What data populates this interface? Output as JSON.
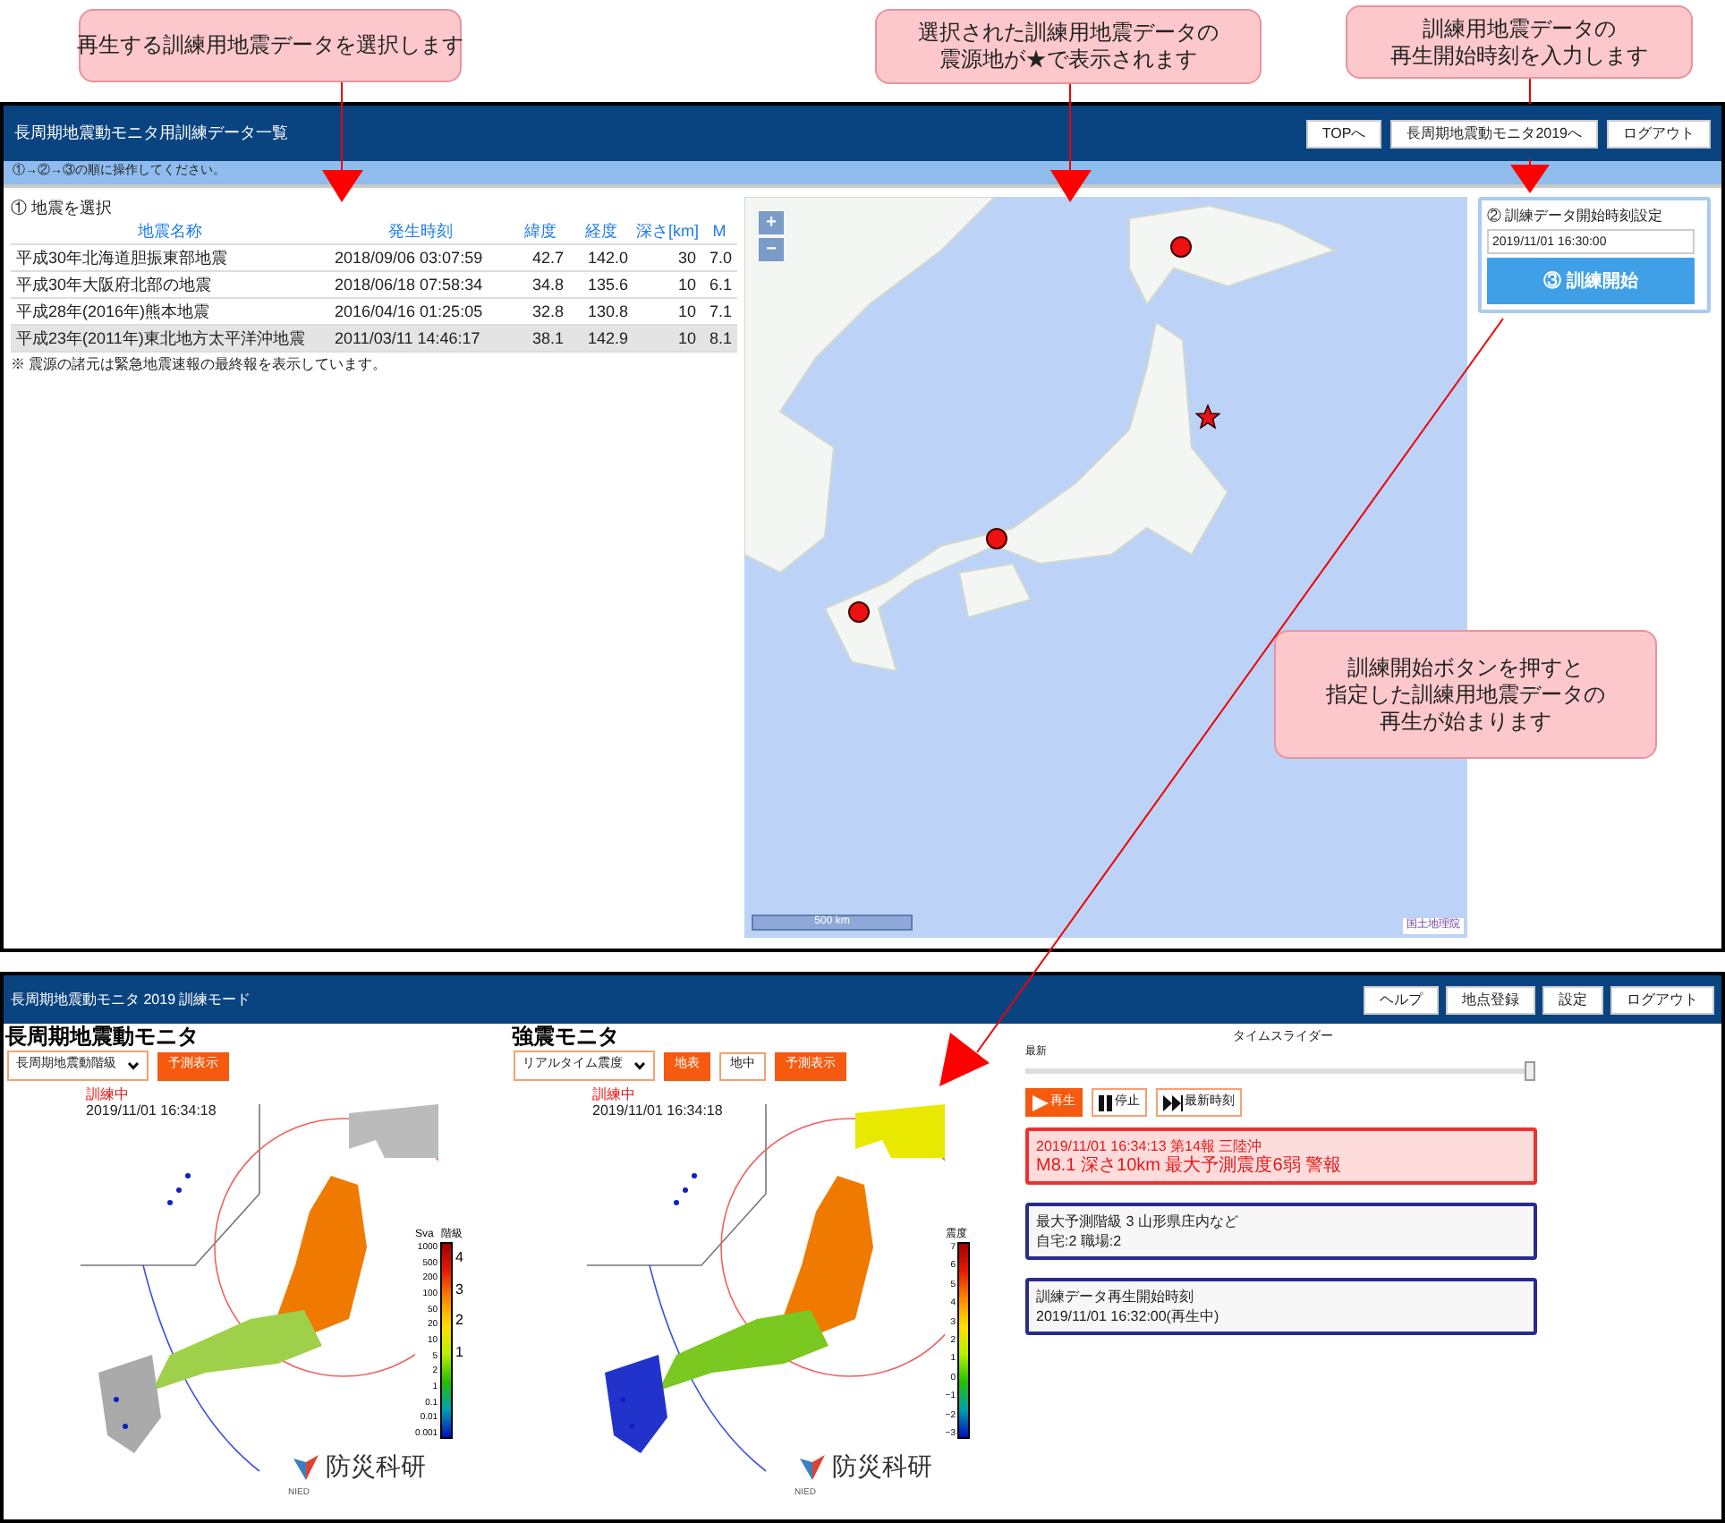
{
  "callouts": [
    {
      "lines": [
        "再生する訓練用地震データを選択します"
      ]
    },
    {
      "lines": [
        "選択された訓練用地震データの",
        "震源地が★で表示されます"
      ]
    },
    {
      "lines": [
        "訓練用地震データの",
        "再生開始時刻を入力します"
      ]
    },
    {
      "lines": [
        "訓練開始ボタンを押すと",
        "指定した訓練用地震データの",
        "再生が始まります"
      ]
    }
  ],
  "training_list_window": {
    "title": "長周期地震動モニタ用訓練データ一覧",
    "header_buttons": [
      "TOPへ",
      "長周期地震動モニタ2019へ",
      "ログアウト"
    ],
    "instruction": "①→②→③の順に操作してください。",
    "step1_label": "① 地震を選択",
    "table": {
      "columns": [
        "地震名称",
        "発生時刻",
        "緯度",
        "経度",
        "深さ[km]",
        "M"
      ],
      "rows": [
        {
          "cells": [
            "平成30年北海道胆振東部地震",
            "2018/09/06 03:07:59",
            "42.7",
            "142.0",
            "30",
            "7.0"
          ],
          "selected": false
        },
        {
          "cells": [
            "平成30年大阪府北部の地震",
            "2018/06/18 07:58:34",
            "34.8",
            "135.6",
            "10",
            "6.1"
          ],
          "selected": false
        },
        {
          "cells": [
            "平成28年(2016年)熊本地震",
            "2016/04/16 01:25:05",
            "32.8",
            "130.8",
            "10",
            "7.1"
          ],
          "selected": false
        },
        {
          "cells": [
            "平成23年(2011年)東北地方太平洋沖地震",
            "2011/03/11 14:46:17",
            "38.1",
            "142.9",
            "10",
            "8.1"
          ],
          "selected": true
        }
      ]
    },
    "note": "※ 震源の諸元は緊急地震速報の最終報を表示しています。",
    "map": {
      "zoom_in": "+",
      "zoom_out": "−",
      "scale": "500 km",
      "attribution": "国土地理院"
    },
    "step2_label": "② 訓練データ開始時刻設定",
    "start_time": "2019/11/01 16:30:00",
    "start_button": "③ 訓練開始"
  },
  "monitor_window": {
    "title": "長周期地震動モニタ 2019 訓練モード",
    "header_buttons": [
      "ヘルプ",
      "地点登録",
      "設定",
      "ログアウト"
    ],
    "monitors": [
      {
        "title": "長周期地震動モニタ",
        "select": "長周期地震動階級",
        "buttons": [
          {
            "label": "予測表示",
            "selected": true
          }
        ],
        "status": "訓練中",
        "time": "2019/11/01 16:34:18",
        "logo_text": "防災科研",
        "logo_sub": "NIED",
        "colorbar": {
          "titles": [
            "Sva",
            "階級"
          ],
          "labels": [
            "1000",
            "500",
            "200",
            "100",
            "50",
            "20",
            "10",
            "5",
            "2",
            "1",
            "0.1",
            "0.01",
            "0.001"
          ],
          "classes": [
            "4",
            "3",
            "2",
            "1"
          ]
        }
      },
      {
        "title": "強震モニタ",
        "select": "リアルタイム震度",
        "buttons": [
          {
            "label": "地表",
            "selected": true
          },
          {
            "label": "地中",
            "selected": false
          },
          {
            "label": "予測表示",
            "selected": true
          }
        ],
        "status": "訓練中",
        "time": "2019/11/01 16:34:18",
        "logo_text": "防災科研",
        "logo_sub": "NIED",
        "colorbar": {
          "titles": [
            "震度"
          ],
          "labels": [
            "7",
            "6",
            "5",
            "4",
            "3",
            "2",
            "1",
            "0",
            "−1",
            "−2",
            "−3"
          ]
        }
      }
    ],
    "slider": {
      "title": "タイムスライダー",
      "label": "最新",
      "level": 1
    },
    "playback_buttons": [
      {
        "label": "再生",
        "kind": "play",
        "selected": true
      },
      {
        "label": "停止",
        "kind": "pause",
        "selected": false
      },
      {
        "label": "最新時刻",
        "kind": "latest",
        "selected": false
      }
    ],
    "cards": [
      {
        "kind": "warning",
        "lines": [
          "2019/11/01 16:34:13 第14報 三陸沖",
          "M8.1 深さ10km 最大予測震度6弱 警報"
        ]
      },
      {
        "kind": "info",
        "lines": [
          "最大予測階級 3 山形県庄内など",
          "自宅:2 職場:2"
        ]
      },
      {
        "kind": "info",
        "lines": [
          "訓練データ再生開始時刻",
          "2019/11/01 16:32:00(再生中)"
        ]
      }
    ]
  }
}
